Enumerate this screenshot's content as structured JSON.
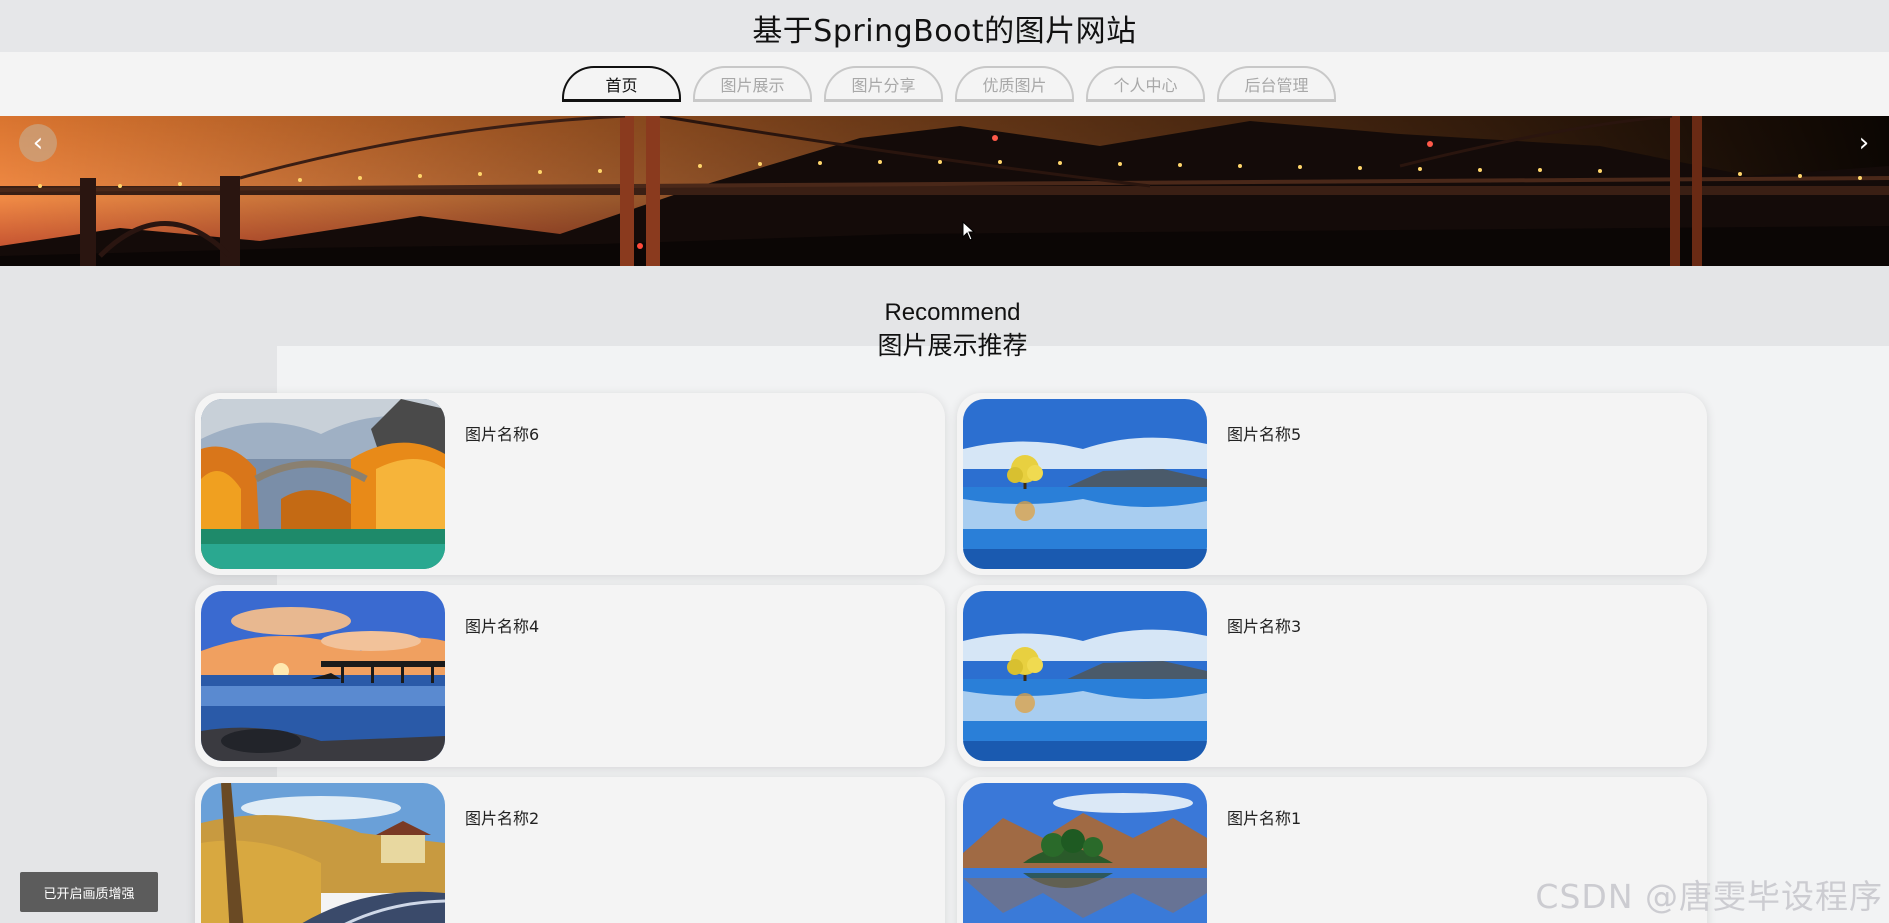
{
  "header": {
    "site_title": "基于SpringBoot的图片网站"
  },
  "nav": {
    "items": [
      {
        "label": "首页",
        "active": true
      },
      {
        "label": "图片展示",
        "active": false
      },
      {
        "label": "图片分享",
        "active": false
      },
      {
        "label": "优质图片",
        "active": false
      },
      {
        "label": "个人中心",
        "active": false
      },
      {
        "label": "后台管理",
        "active": false
      }
    ]
  },
  "banner": {
    "prev_icon": "chevron-left-icon",
    "next_icon": "chevron-right-icon",
    "prev_glyph": "‹",
    "next_glyph": "›"
  },
  "recommend": {
    "title_en": "Recommend",
    "title_cn": "图片展示推荐",
    "cards": [
      {
        "name": "图片名称6",
        "image": "autumn-bridge"
      },
      {
        "name": "图片名称5",
        "image": "lake-tree"
      },
      {
        "name": "图片名称4",
        "image": "sunset-pier"
      },
      {
        "name": "图片名称3",
        "image": "lake-tree"
      },
      {
        "name": "图片名称2",
        "image": "country-road"
      },
      {
        "name": "图片名称1",
        "image": "mountain-lake"
      }
    ]
  },
  "footer": {
    "enhance_label": "已开启画质增强",
    "watermark": "CSDN @唐雯毕设程序"
  },
  "colors": {
    "title_bg": "#e6e7e9",
    "nav_bg": "#f4f4f4",
    "nav_active": "#111111",
    "nav_inactive": "#a8a8a8",
    "card_bg": "#f4f4f4"
  }
}
